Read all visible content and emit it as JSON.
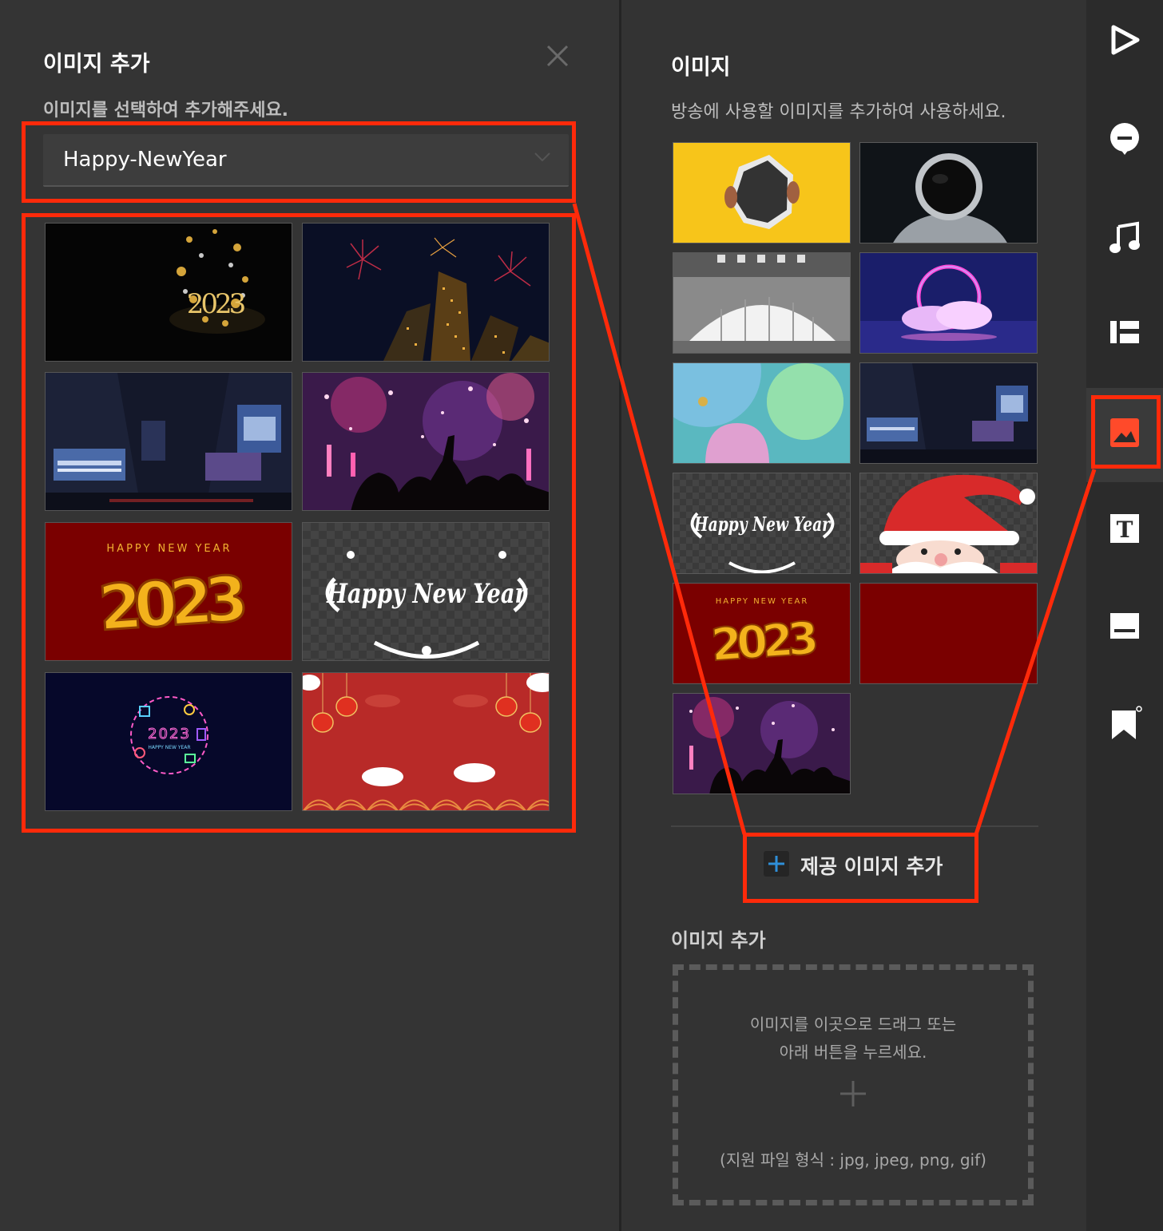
{
  "add_panel": {
    "title": "이미지 추가",
    "subtitle": "이미지를 선택하여 추가해주세요.",
    "dropdown_value": "Happy-NewYear",
    "thumbnails": [
      {
        "name": "2023-gold-ornaments",
        "overlay": "2023"
      },
      {
        "name": "fireworks-skyscrapers"
      },
      {
        "name": "times-square-night"
      },
      {
        "name": "concert-crowd-fireworks"
      },
      {
        "name": "happy-new-year-2023-red",
        "caption": "HAPPY NEW YEAR",
        "overlay": "2023"
      },
      {
        "name": "happy-new-year-lettering",
        "overlay": "Happy New Year"
      },
      {
        "name": "neon-2023-icons",
        "overlay": "2023",
        "caption": "HAPPY NEW YEAR"
      },
      {
        "name": "red-lanterns-clouds"
      }
    ]
  },
  "images_panel": {
    "title": "이미지",
    "description": "방송에 사용할 이미지를 추가하여 사용하세요.",
    "images": [
      {
        "name": "yellow-torn-paper"
      },
      {
        "name": "astronaut"
      },
      {
        "name": "arched-hall"
      },
      {
        "name": "neon-ring-cloud"
      },
      {
        "name": "pastel-spheres"
      },
      {
        "name": "times-square-night"
      },
      {
        "name": "happy-new-year-lettering",
        "overlay": "Happy New Year"
      },
      {
        "name": "santa-claus"
      },
      {
        "name": "happy-new-year-2023-red",
        "caption": "HAPPY NEW YEAR",
        "overlay": "2023"
      },
      {
        "name": "plain-dark-red"
      },
      {
        "name": "concert-crowd-fireworks"
      }
    ],
    "add_provided_button": "제공 이미지 추가",
    "upload_title": "이미지 추가",
    "dropzone_line1": "이미지를 이곳으로 드래그 또는",
    "dropzone_line2": "아래 버튼을 누르세요.",
    "dropzone_formats": "(지원 파일 형식 : jpg, jpeg, png, gif)"
  },
  "sidebar": {
    "items": [
      {
        "icon": "play-icon"
      },
      {
        "icon": "chat-bubble-icon"
      },
      {
        "icon": "music-note-icon"
      },
      {
        "icon": "layout-icon"
      },
      {
        "icon": "image-icon",
        "active": true
      },
      {
        "icon": "text-icon",
        "overlay": "T"
      },
      {
        "icon": "subtitle-bar-icon"
      },
      {
        "icon": "bookmark-icon"
      }
    ]
  },
  "colors": {
    "panel_bg": "#343434",
    "sidebar_bg": "#2b2b2b",
    "highlight": "#ff2a0a",
    "accent_blue": "#2f8fd8"
  }
}
